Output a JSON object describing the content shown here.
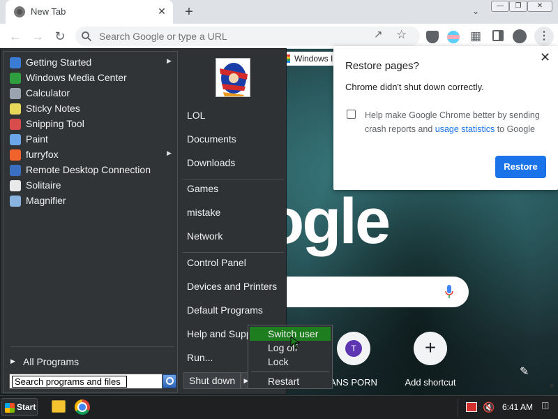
{
  "browser": {
    "tab_title": "New Tab",
    "tab_close": "✕",
    "new_tab": "+",
    "omnibox_placeholder": "Search Google or type a URL",
    "partial_tab_title": "Windows I"
  },
  "ntp": {
    "logo_text": "ogle",
    "shortcuts": [
      {
        "label": "ANS PORN",
        "initial": "T"
      },
      {
        "label": "Add shortcut",
        "glyph": "+"
      }
    ]
  },
  "restore_dialog": {
    "title": "Restore pages?",
    "message": "Chrome didn't shut down correctly.",
    "checkbox_text_1": "Help make Google Chrome better by sending crash reports and ",
    "checkbox_link": "usage statistics",
    "checkbox_text_2": " to Google",
    "button": "Restore",
    "close": "✕"
  },
  "start_menu": {
    "programs": [
      {
        "label": "Getting Started",
        "icon": "getting-started-icon",
        "color": "#3a7bd5",
        "arrow": true
      },
      {
        "label": "Windows Media Center",
        "icon": "media-center-icon",
        "color": "#2e9e3e",
        "arrow": false
      },
      {
        "label": "Calculator",
        "icon": "calculator-icon",
        "color": "#9aa4b0",
        "arrow": false
      },
      {
        "label": "Sticky Notes",
        "icon": "sticky-notes-icon",
        "color": "#e8d85a",
        "arrow": false
      },
      {
        "label": "Snipping Tool",
        "icon": "snipping-tool-icon",
        "color": "#d94c4c",
        "arrow": false
      },
      {
        "label": "Paint",
        "icon": "paint-icon",
        "color": "#6aa6e8",
        "arrow": false
      },
      {
        "label": "furryfox",
        "icon": "firefox-icon",
        "color": "#f0632c",
        "arrow": true
      },
      {
        "label": "Remote Desktop Connection",
        "icon": "remote-desktop-icon",
        "color": "#3b6fc2",
        "arrow": false
      },
      {
        "label": "Solitaire",
        "icon": "solitaire-icon",
        "color": "#e9e9e9",
        "arrow": false
      },
      {
        "label": "Magnifier",
        "icon": "magnifier-icon",
        "color": "#8ab4e0",
        "arrow": false
      }
    ],
    "all_programs": "All Programs",
    "search_value": "Search programs and files",
    "right_items_group1": [
      "LOL",
      "Documents",
      "Downloads"
    ],
    "right_items_group2": [
      "Games",
      "mistake",
      "Network"
    ],
    "right_items_group3": [
      "Control Panel",
      "Devices and Printers",
      "Default Programs",
      "Help and Support",
      "Run..."
    ],
    "shutdown": "Shut down",
    "submenu": [
      "Switch user",
      "Log off",
      "Lock",
      "Restart"
    ]
  },
  "taskbar": {
    "start": "Start",
    "clock": "6:41 AM"
  }
}
